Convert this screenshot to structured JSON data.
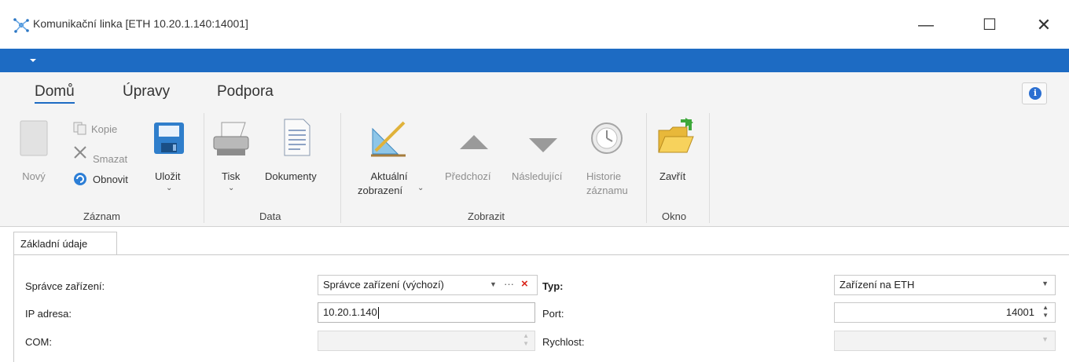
{
  "window": {
    "title": "Komunikační linka [ETH 10.20.1.140:14001]",
    "min_glyph": "—",
    "max_glyph": "☐",
    "close_glyph": "✕"
  },
  "ribbon": {
    "tabs": [
      {
        "label": "Domů",
        "active": true
      },
      {
        "label": "Úpravy",
        "active": false
      },
      {
        "label": "Podpora",
        "active": false
      }
    ],
    "groups": {
      "zaznam": {
        "label": "Záznam",
        "novy": "Nový",
        "kopie": "Kopie",
        "smazat": "Smazat",
        "obnovit": "Obnovit",
        "ulozit": "Uložit"
      },
      "data": {
        "label": "Data",
        "tisk": "Tisk",
        "dokumenty": "Dokumenty"
      },
      "zobrazit": {
        "label": "Zobrazit",
        "aktualni_1": "Aktuální",
        "aktualni_2": "zobrazení",
        "predchozi": "Předchozí",
        "nasledujici": "Následující",
        "historie_1": "Historie",
        "historie_2": "záznamu"
      },
      "okno": {
        "label": "Okno",
        "zavrit": "Zavřít"
      }
    },
    "chevron": "⌄",
    "info": "i"
  },
  "page_tab": "Základní údaje",
  "form": {
    "spravce_label": "Správce zařízení:",
    "spravce_value": "Správce zařízení (výchozí)",
    "spravce_more": "···",
    "spravce_clear": "×",
    "typ_label": "Typ:",
    "typ_value": "Zařízení na ETH",
    "ip_label": "IP adresa:",
    "ip_value": "10.20.1.140",
    "port_label": "Port:",
    "port_value": "14001",
    "com_label": "COM:",
    "com_value": "",
    "rychlost_label": "Rychlost:",
    "rychlost_value": ""
  },
  "colors": {
    "accent": "#1d6bc3",
    "ribbon_bg": "#f4f4f4",
    "clear_red": "#d9261c"
  }
}
